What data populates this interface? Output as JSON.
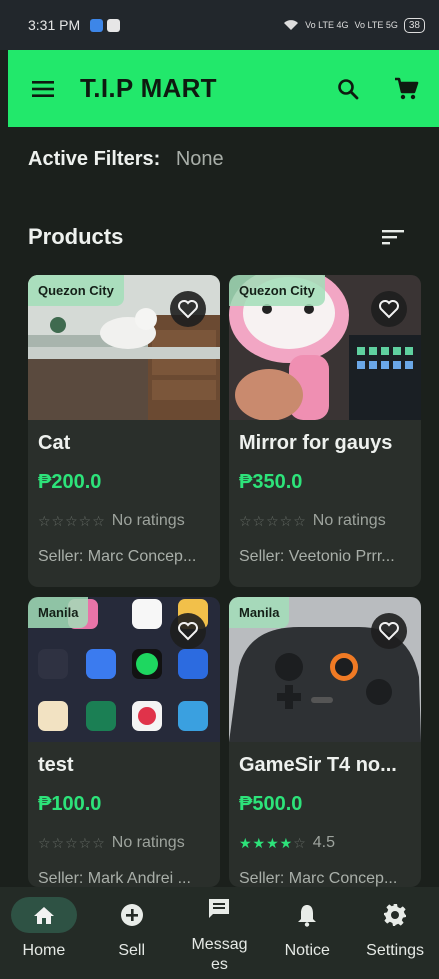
{
  "status_bar": {
    "time": "3:31 PM",
    "signal_text_1": "Vo LTE 4G",
    "signal_text_2": "Vo LTE 5G",
    "battery": "38"
  },
  "app_bar": {
    "title": "T.I.P MART",
    "icons": [
      "menu-icon",
      "search-icon",
      "cart-icon"
    ],
    "background": "#22e86b"
  },
  "filters": {
    "label": "Active Filters:",
    "value": "None"
  },
  "products": {
    "title": "Products",
    "accent": "#2de37a",
    "items": [
      {
        "location": "Quezon City",
        "name": "Cat",
        "price": "₱200.0",
        "rating_text": "No ratings",
        "rating_stars": 0,
        "seller": "Seller: Marc Concep..."
      },
      {
        "location": "Quezon City",
        "name": "Mirror for gauys",
        "price": "₱350.0",
        "rating_text": "No ratings",
        "rating_stars": 0,
        "seller": "Seller: Veetonio Prrr..."
      },
      {
        "location": "Manila",
        "name": "test",
        "price": "₱100.0",
        "rating_text": "No ratings",
        "rating_stars": 0,
        "seller": "Seller: Mark Andrei ..."
      },
      {
        "location": "Manila",
        "name": "GameSir T4 no...",
        "price": "₱500.0",
        "rating_text": "4.5",
        "rating_stars": 4,
        "seller": "Seller: Marc Concep..."
      }
    ]
  },
  "bottom_nav": {
    "items": [
      {
        "label": "Home",
        "icon": "home-icon",
        "active": true
      },
      {
        "label": "Sell",
        "icon": "add-circle-icon",
        "active": false
      },
      {
        "label": "Messages",
        "icon": "message-icon",
        "active": false
      },
      {
        "label": "Notice",
        "icon": "bell-icon",
        "active": false
      },
      {
        "label": "Settings",
        "icon": "gear-icon",
        "active": false
      }
    ]
  }
}
